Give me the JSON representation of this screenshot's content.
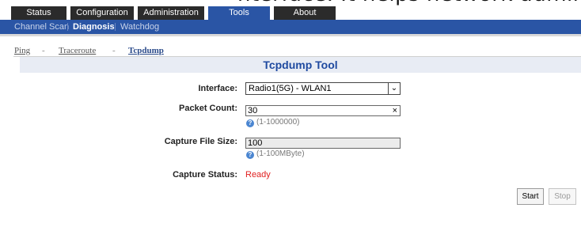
{
  "banner_text": "nterface. It helps network administrator for troubl",
  "main_nav": {
    "tabs": [
      {
        "label": "Status"
      },
      {
        "label": "Configuration"
      },
      {
        "label": "Administration"
      },
      {
        "label": "Tools",
        "active": true
      },
      {
        "label": "About"
      }
    ]
  },
  "sub_nav": {
    "items": [
      {
        "label": "Channel Scan"
      },
      {
        "label": "Diagnosis",
        "active": true
      },
      {
        "label": "Watchdog"
      }
    ]
  },
  "breadcrumb": {
    "items": [
      "Ping",
      "Traceroute",
      "Tcpdump"
    ],
    "separator": "-"
  },
  "panel": {
    "title": "Tcpdump Tool",
    "interface": {
      "label": "Interface:",
      "value": "Radio1(5G) - WLAN1"
    },
    "packet_count": {
      "label": "Packet Count:",
      "value": "30",
      "hint": "(1-1000000)"
    },
    "capture_file_size": {
      "label": "Capture File Size:",
      "value": "100",
      "hint": "(1-100MByte)"
    },
    "capture_status": {
      "label": "Capture Status:",
      "value": "Ready"
    }
  },
  "buttons": {
    "start": "Start",
    "stop": "Stop"
  },
  "colors": {
    "nav_blue": "#2a55a5",
    "tab_dark": "#2b2b2b",
    "status_red": "#e02020",
    "title_blue": "#1f4aa0"
  }
}
